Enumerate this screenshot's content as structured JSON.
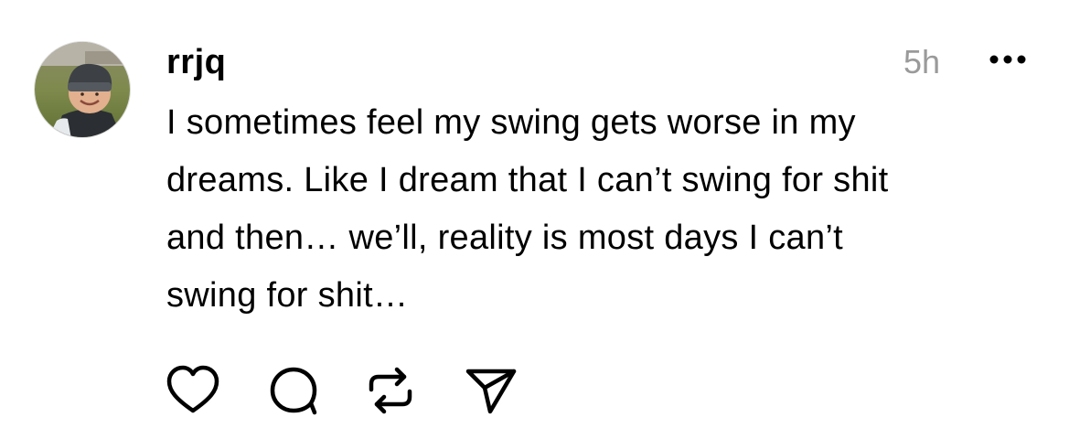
{
  "post": {
    "username": "rrjq",
    "timestamp": "5h",
    "text_lines": [
      "I sometimes feel my swing gets worse in my",
      "dreams. Like I dream that I can’t swing for shit",
      "and then… we’ll, reality is most days I can’t",
      "swing for shit…"
    ]
  },
  "icons": {
    "more": "more-dots-icon",
    "like": "heart-icon",
    "reply": "comment-bubble-icon",
    "repost": "repost-icon",
    "share": "send-paper-plane-icon"
  },
  "colors": {
    "text": "#000000",
    "timestamp": "#9a9a9a",
    "background": "#ffffff"
  }
}
